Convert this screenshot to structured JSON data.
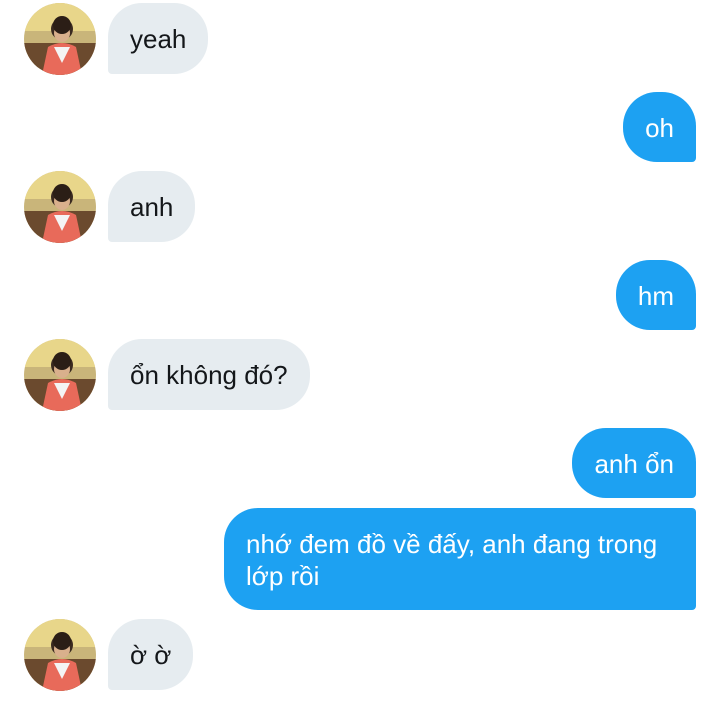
{
  "messages": [
    {
      "from": "them",
      "text": "yeah"
    },
    {
      "from": "me",
      "text": "oh"
    },
    {
      "from": "them",
      "text": "anh"
    },
    {
      "from": "me",
      "text": "hm"
    },
    {
      "from": "them",
      "text": "ổn không đó?"
    },
    {
      "from": "me",
      "text": "anh ổn"
    },
    {
      "from": "me",
      "text": "nhớ đem đồ về đấy, anh đang trong lớp rồi"
    },
    {
      "from": "them",
      "text": "ờ ờ"
    }
  ],
  "colors": {
    "incoming_bubble": "#e6ecf0",
    "incoming_text": "#14171a",
    "outgoing_bubble": "#1da1f2",
    "outgoing_text": "#ffffff"
  },
  "icons": {
    "contact_avatar": "contact-avatar"
  }
}
